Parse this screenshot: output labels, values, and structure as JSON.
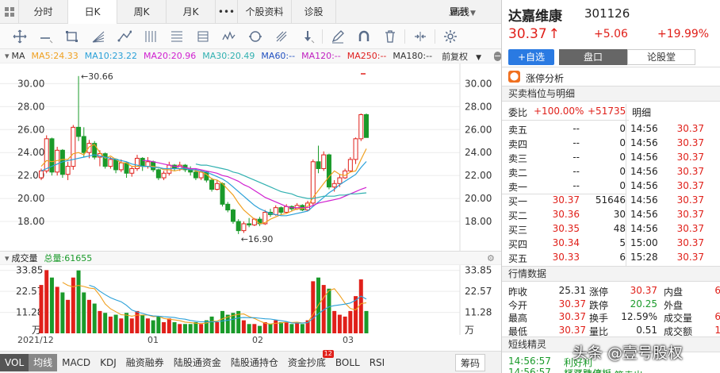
{
  "tabs": {
    "fenshi": "分时",
    "rik": "日K",
    "zhouk": "周K",
    "yuek": "月K",
    "more": "•••",
    "profile": "个股资料",
    "diagnose": "诊股",
    "display": "显示",
    "draw": "画线"
  },
  "ma_bar": {
    "ma": "MA",
    "ma5": "MA5:24.33",
    "ma10": "MA10:23.22",
    "ma20": "MA20:20.96",
    "ma30": "MA30:20.49",
    "ma60": "MA60:--",
    "ma120": "MA120:--",
    "ma250": "MA250:--",
    "ma180": "MA180:--",
    "adjust": "前复权"
  },
  "colors": {
    "ma5": "#f0a020",
    "ma10": "#2aa0d8",
    "ma20": "#d020d0",
    "ma30": "#30b0b0",
    "ma60": "#2050c0",
    "ma120": "#c020c0",
    "ma250": "#e02020",
    "ma180": "#333333",
    "up": "#e0201a",
    "down": "#1a9a2a"
  },
  "price_axis": {
    "labels": [
      "30.00",
      "28.00",
      "26.00",
      "24.00",
      "22.00",
      "20.00",
      "18.00"
    ],
    "max_label": "←30.66",
    "min_label": "←16.90"
  },
  "vol_header": {
    "title": "成交量",
    "total": "总量:61655"
  },
  "vol_axis": {
    "labels": [
      "33.85",
      "22.57",
      "11.28",
      "万"
    ]
  },
  "dates": [
    "2021/12",
    "01",
    "02",
    "03"
  ],
  "bottom_tabs": [
    "VOL",
    "均线",
    "MACD",
    "KDJ",
    "融资融券",
    "陆股通资金",
    "陆股通持仓",
    "资金抄底",
    "BOLL",
    "RSI",
    "筹码"
  ],
  "badge": "12",
  "chart_data": {
    "type": "candlestick",
    "ylim": [
      16.0,
      31.2
    ],
    "vol_ylim": [
      0,
      35
    ],
    "candles": [
      [
        21.8,
        22.6,
        21.6,
        22.4,
        26
      ],
      [
        22.4,
        25.5,
        22.2,
        25.2,
        34
      ],
      [
        25.2,
        25.3,
        22.0,
        22.3,
        30
      ],
      [
        22.3,
        24.5,
        22.0,
        24.2,
        25
      ],
      [
        24.2,
        24.3,
        21.8,
        22.1,
        22
      ],
      [
        22.1,
        23.2,
        21.6,
        22.8,
        18
      ],
      [
        22.8,
        26.4,
        22.5,
        26.2,
        30
      ],
      [
        26.2,
        30.66,
        25.0,
        25.4,
        33.85
      ],
      [
        25.4,
        26.2,
        23.6,
        24.0,
        22
      ],
      [
        24.0,
        25.1,
        23.5,
        24.8,
        18
      ],
      [
        24.8,
        25.0,
        23.4,
        23.6,
        16
      ],
      [
        23.6,
        24.2,
        22.8,
        23.9,
        12
      ],
      [
        23.9,
        24.0,
        22.6,
        22.8,
        11
      ],
      [
        22.8,
        23.6,
        22.6,
        23.4,
        9
      ],
      [
        23.4,
        23.5,
        22.2,
        22.5,
        10
      ],
      [
        22.5,
        23.4,
        22.3,
        23.1,
        8
      ],
      [
        23.1,
        23.2,
        21.8,
        22.2,
        11
      ],
      [
        22.2,
        22.8,
        21.9,
        22.6,
        8
      ],
      [
        22.6,
        23.8,
        22.4,
        23.5,
        12
      ],
      [
        23.5,
        23.6,
        22.4,
        22.8,
        10
      ],
      [
        22.8,
        23.6,
        22.6,
        23.2,
        8
      ],
      [
        23.2,
        23.3,
        22.3,
        22.5,
        7
      ],
      [
        22.5,
        22.6,
        21.6,
        21.8,
        9
      ],
      [
        21.8,
        22.4,
        21.6,
        22.2,
        6
      ],
      [
        22.2,
        23.2,
        22.0,
        22.9,
        8
      ],
      [
        22.9,
        23.0,
        22.4,
        22.6,
        6
      ],
      [
        22.6,
        23.2,
        22.4,
        22.9,
        5
      ],
      [
        22.9,
        23.0,
        22.3,
        22.5,
        5
      ],
      [
        22.5,
        22.8,
        22.0,
        22.3,
        5
      ],
      [
        22.3,
        22.6,
        21.6,
        21.8,
        6
      ],
      [
        21.8,
        22.5,
        21.6,
        22.3,
        5
      ],
      [
        22.3,
        22.4,
        21.4,
        21.6,
        7
      ],
      [
        21.6,
        21.8,
        20.6,
        20.8,
        9
      ],
      [
        20.8,
        21.6,
        20.7,
        21.3,
        6
      ],
      [
        21.3,
        21.4,
        19.3,
        19.5,
        12
      ],
      [
        19.5,
        19.7,
        18.8,
        19.0,
        10
      ],
      [
        19.0,
        19.1,
        17.8,
        18.0,
        11
      ],
      [
        18.0,
        18.2,
        16.9,
        17.2,
        12
      ],
      [
        17.2,
        18.0,
        17.0,
        17.8,
        7
      ],
      [
        17.8,
        18.3,
        17.5,
        17.7,
        5
      ],
      [
        17.7,
        18.3,
        17.6,
        18.2,
        5
      ],
      [
        18.2,
        18.4,
        17.6,
        17.8,
        4
      ],
      [
        17.8,
        19.0,
        17.7,
        18.8,
        6
      ],
      [
        18.8,
        19.1,
        18.4,
        18.6,
        5
      ],
      [
        18.6,
        19.4,
        18.5,
        19.2,
        7
      ],
      [
        19.2,
        19.3,
        18.6,
        18.8,
        6
      ],
      [
        18.8,
        19.5,
        18.7,
        19.3,
        6
      ],
      [
        19.3,
        19.4,
        18.9,
        19.1,
        5
      ],
      [
        19.1,
        19.6,
        19.0,
        19.4,
        6
      ],
      [
        19.4,
        19.5,
        18.9,
        19.0,
        5
      ],
      [
        19.0,
        19.8,
        18.9,
        19.6,
        7
      ],
      [
        19.6,
        23.4,
        19.4,
        23.2,
        28
      ],
      [
        23.2,
        24.6,
        22.2,
        22.6,
        30
      ],
      [
        22.6,
        24.1,
        22.4,
        23.8,
        26
      ],
      [
        23.8,
        23.9,
        20.8,
        21.0,
        24
      ],
      [
        21.0,
        21.6,
        20.6,
        21.3,
        12
      ],
      [
        21.3,
        22.1,
        21.0,
        21.8,
        10
      ],
      [
        21.8,
        22.6,
        21.7,
        22.4,
        9
      ],
      [
        22.4,
        23.6,
        22.3,
        23.4,
        12
      ],
      [
        23.4,
        25.31,
        23.0,
        25.2,
        20
      ],
      [
        25.2,
        27.4,
        25.0,
        27.3,
        29
      ],
      [
        27.3,
        27.4,
        25.3,
        25.31,
        12
      ]
    ],
    "ma5": [
      22.8,
      23.3,
      23.2,
      23.3,
      23.4,
      23.4,
      23.9,
      24.0,
      23.8,
      24.5,
      24.7,
      24.0,
      23.5,
      23.7,
      23.4,
      23.1,
      23.1,
      22.8,
      22.8,
      22.8,
      22.8,
      22.8,
      22.7,
      22.5,
      22.5,
      22.4,
      22.5,
      22.6,
      22.6,
      22.4,
      22.3,
      22.1,
      21.7,
      21.6,
      21.3,
      20.8,
      20.3,
      19.6,
      19.0,
      18.6,
      18.2,
      17.8,
      17.9,
      18.2,
      18.4,
      18.6,
      18.7,
      18.9,
      19.1,
      19.1,
      19.3,
      20.1,
      20.7,
      21.3,
      21.9,
      22.4,
      22.1,
      22.0,
      22.3,
      22.4,
      23.4,
      24.33
    ],
    "ma10": [
      22.4,
      22.6,
      22.8,
      23.0,
      23.2,
      23.3,
      23.4,
      23.5,
      23.6,
      23.7,
      23.8,
      23.7,
      23.6,
      23.5,
      23.4,
      23.3,
      23.2,
      23.0,
      22.9,
      22.8,
      22.8,
      22.7,
      22.7,
      22.6,
      22.6,
      22.6,
      22.6,
      22.6,
      22.5,
      22.5,
      22.4,
      22.3,
      22.1,
      21.9,
      21.7,
      21.4,
      21.0,
      20.6,
      20.2,
      19.8,
      19.4,
      19.1,
      18.9,
      18.7,
      18.6,
      18.5,
      18.5,
      18.6,
      18.7,
      18.8,
      18.9,
      19.3,
      19.7,
      20.1,
      20.5,
      20.8,
      21.2,
      21.5,
      21.8,
      22.1,
      22.7,
      23.22
    ],
    "ma20": [
      null,
      null,
      null,
      null,
      null,
      null,
      null,
      null,
      null,
      null,
      null,
      null,
      null,
      null,
      null,
      null,
      null,
      null,
      null,
      23.3,
      23.3,
      23.2,
      23.1,
      23.0,
      22.9,
      22.8,
      22.8,
      22.7,
      22.6,
      22.6,
      22.5,
      22.4,
      22.3,
      22.2,
      22.0,
      21.9,
      21.7,
      21.5,
      21.2,
      21.0,
      20.7,
      20.4,
      20.1,
      19.9,
      19.7,
      19.5,
      19.3,
      19.2,
      19.2,
      19.2,
      19.2,
      19.4,
      19.6,
      19.7,
      19.8,
      19.9,
      20.0,
      20.2,
      20.4,
      20.6,
      20.8,
      20.96
    ],
    "ma30": [
      null,
      null,
      null,
      null,
      null,
      null,
      null,
      null,
      null,
      null,
      null,
      null,
      null,
      null,
      null,
      null,
      null,
      null,
      null,
      null,
      null,
      null,
      null,
      null,
      null,
      null,
      null,
      null,
      null,
      23.0,
      22.9,
      22.9,
      22.8,
      22.7,
      22.6,
      22.5,
      22.3,
      22.2,
      22.0,
      21.8,
      21.6,
      21.4,
      21.2,
      21.0,
      20.8,
      20.6,
      20.5,
      20.4,
      20.2,
      20.1,
      20.0,
      20.0,
      20.1,
      20.2,
      20.2,
      20.2,
      20.3,
      20.3,
      20.4,
      20.4,
      20.45,
      20.49
    ]
  },
  "right": {
    "name": "达嘉维康",
    "code": "301126",
    "price": "30.37",
    "arrow": "↑",
    "change": "+5.06",
    "pct": "+19.99%",
    "add_fav": "+自选",
    "tab_pankou": "盘口",
    "tab_lun": "论股堂",
    "limit_analysis": "涨停分析",
    "sect_orders": "买卖档位与明细",
    "weibi_label": "委比",
    "weibi_pct": "+100.00%",
    "weibi_val": "+51735",
    "detail_label": "明细",
    "sells": [
      {
        "l": "卖五",
        "p": "--",
        "v": "0"
      },
      {
        "l": "卖四",
        "p": "--",
        "v": "0"
      },
      {
        "l": "卖三",
        "p": "--",
        "v": "0"
      },
      {
        "l": "卖二",
        "p": "--",
        "v": "0"
      },
      {
        "l": "卖一",
        "p": "--",
        "v": "0"
      }
    ],
    "buys": [
      {
        "l": "买一",
        "p": "30.37",
        "v": "51646"
      },
      {
        "l": "买二",
        "p": "30.36",
        "v": "30"
      },
      {
        "l": "买三",
        "p": "30.35",
        "v": "48"
      },
      {
        "l": "买四",
        "p": "30.34",
        "v": "5"
      },
      {
        "l": "买五",
        "p": "30.33",
        "v": "6"
      }
    ],
    "details": [
      {
        "t": "14:56",
        "p": "30.37"
      },
      {
        "t": "14:56",
        "p": "30.37"
      },
      {
        "t": "14:56",
        "p": "30.37"
      },
      {
        "t": "14:56",
        "p": "30.37"
      },
      {
        "t": "14:56",
        "p": "30.37"
      },
      {
        "t": "14:56",
        "p": "30.37"
      },
      {
        "t": "14:56",
        "p": "30.37"
      },
      {
        "t": "14:56",
        "p": "30.37"
      },
      {
        "t": "15:00",
        "p": "30.37"
      },
      {
        "t": "15:28",
        "p": "30.37"
      }
    ],
    "sect_quote": "行情数据",
    "quote": [
      {
        "a": "昨收",
        "b": "25.31",
        "c": "涨停",
        "d": "30.37",
        "e": "内盘",
        "f": "6"
      },
      {
        "a": "今开",
        "b": "30.37",
        "c": "跌停",
        "d": "20.25",
        "e": "外盘",
        "f": ""
      },
      {
        "a": "最高",
        "b": "30.37",
        "c": "换手",
        "d": "12.59%",
        "e": "成交量",
        "f": "6"
      },
      {
        "a": "最低",
        "b": "30.37",
        "c": "量比",
        "d": "0.51",
        "e": "成交额",
        "f": "1"
      }
    ],
    "sect_short": "短线精灵",
    "short": [
      {
        "t": "14:56:57",
        "txt": "利好利"
      },
      {
        "t": "14:56:57",
        "txt": "打开跌停板"
      }
    ],
    "short3": "华通线缆   大笔卖出"
  },
  "watermark": "头条 @壹号股权"
}
